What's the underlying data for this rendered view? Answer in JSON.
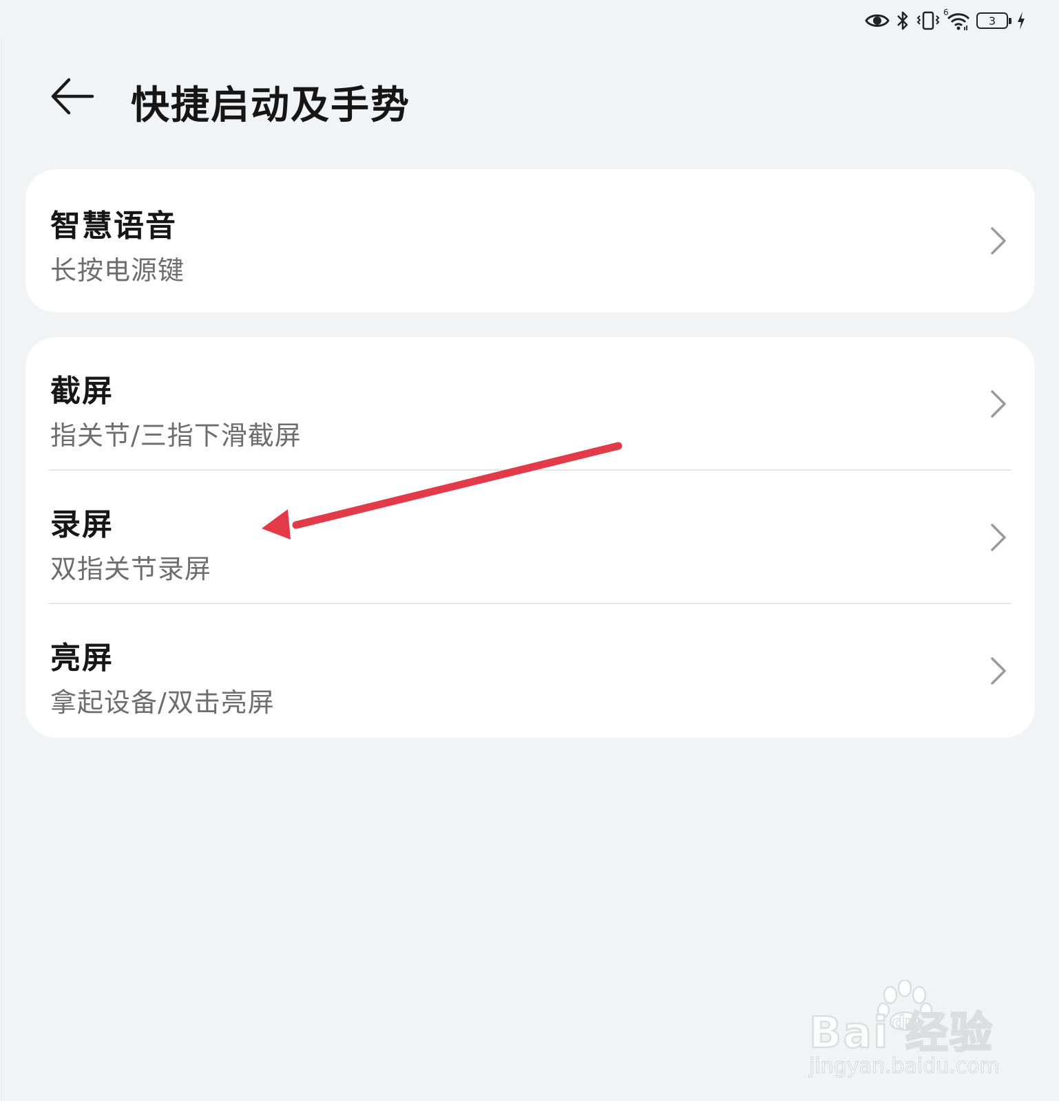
{
  "status_bar": {
    "battery_level": "3",
    "icons": [
      "eye-icon",
      "bluetooth-icon",
      "vibrate-icon",
      "wifi-icon",
      "battery-icon",
      "charging-icon"
    ],
    "wifi_badge": "6"
  },
  "header": {
    "back_icon": "arrow-left-icon",
    "title": "快捷启动及手势"
  },
  "cards": [
    {
      "items": [
        {
          "title": "智慧语音",
          "subtitle": "长按电源键"
        }
      ]
    },
    {
      "items": [
        {
          "title": "截屏",
          "subtitle": "指关节/三指下滑截屏"
        },
        {
          "title": "录屏",
          "subtitle": "双指关节录屏"
        },
        {
          "title": "亮屏",
          "subtitle": "拿起设备/双击亮屏"
        }
      ]
    }
  ],
  "annotation": {
    "arrow_color": "#e23a48"
  },
  "watermark": {
    "logo": "Bai  经验",
    "url": "jingyan.baidu.com",
    "du": "du"
  },
  "colors": {
    "background": "#f1f3f5",
    "card": "#ffffff",
    "title_text": "#161616",
    "subtitle_text": "#6d6d6d",
    "chevron": "#9a9a9a"
  }
}
